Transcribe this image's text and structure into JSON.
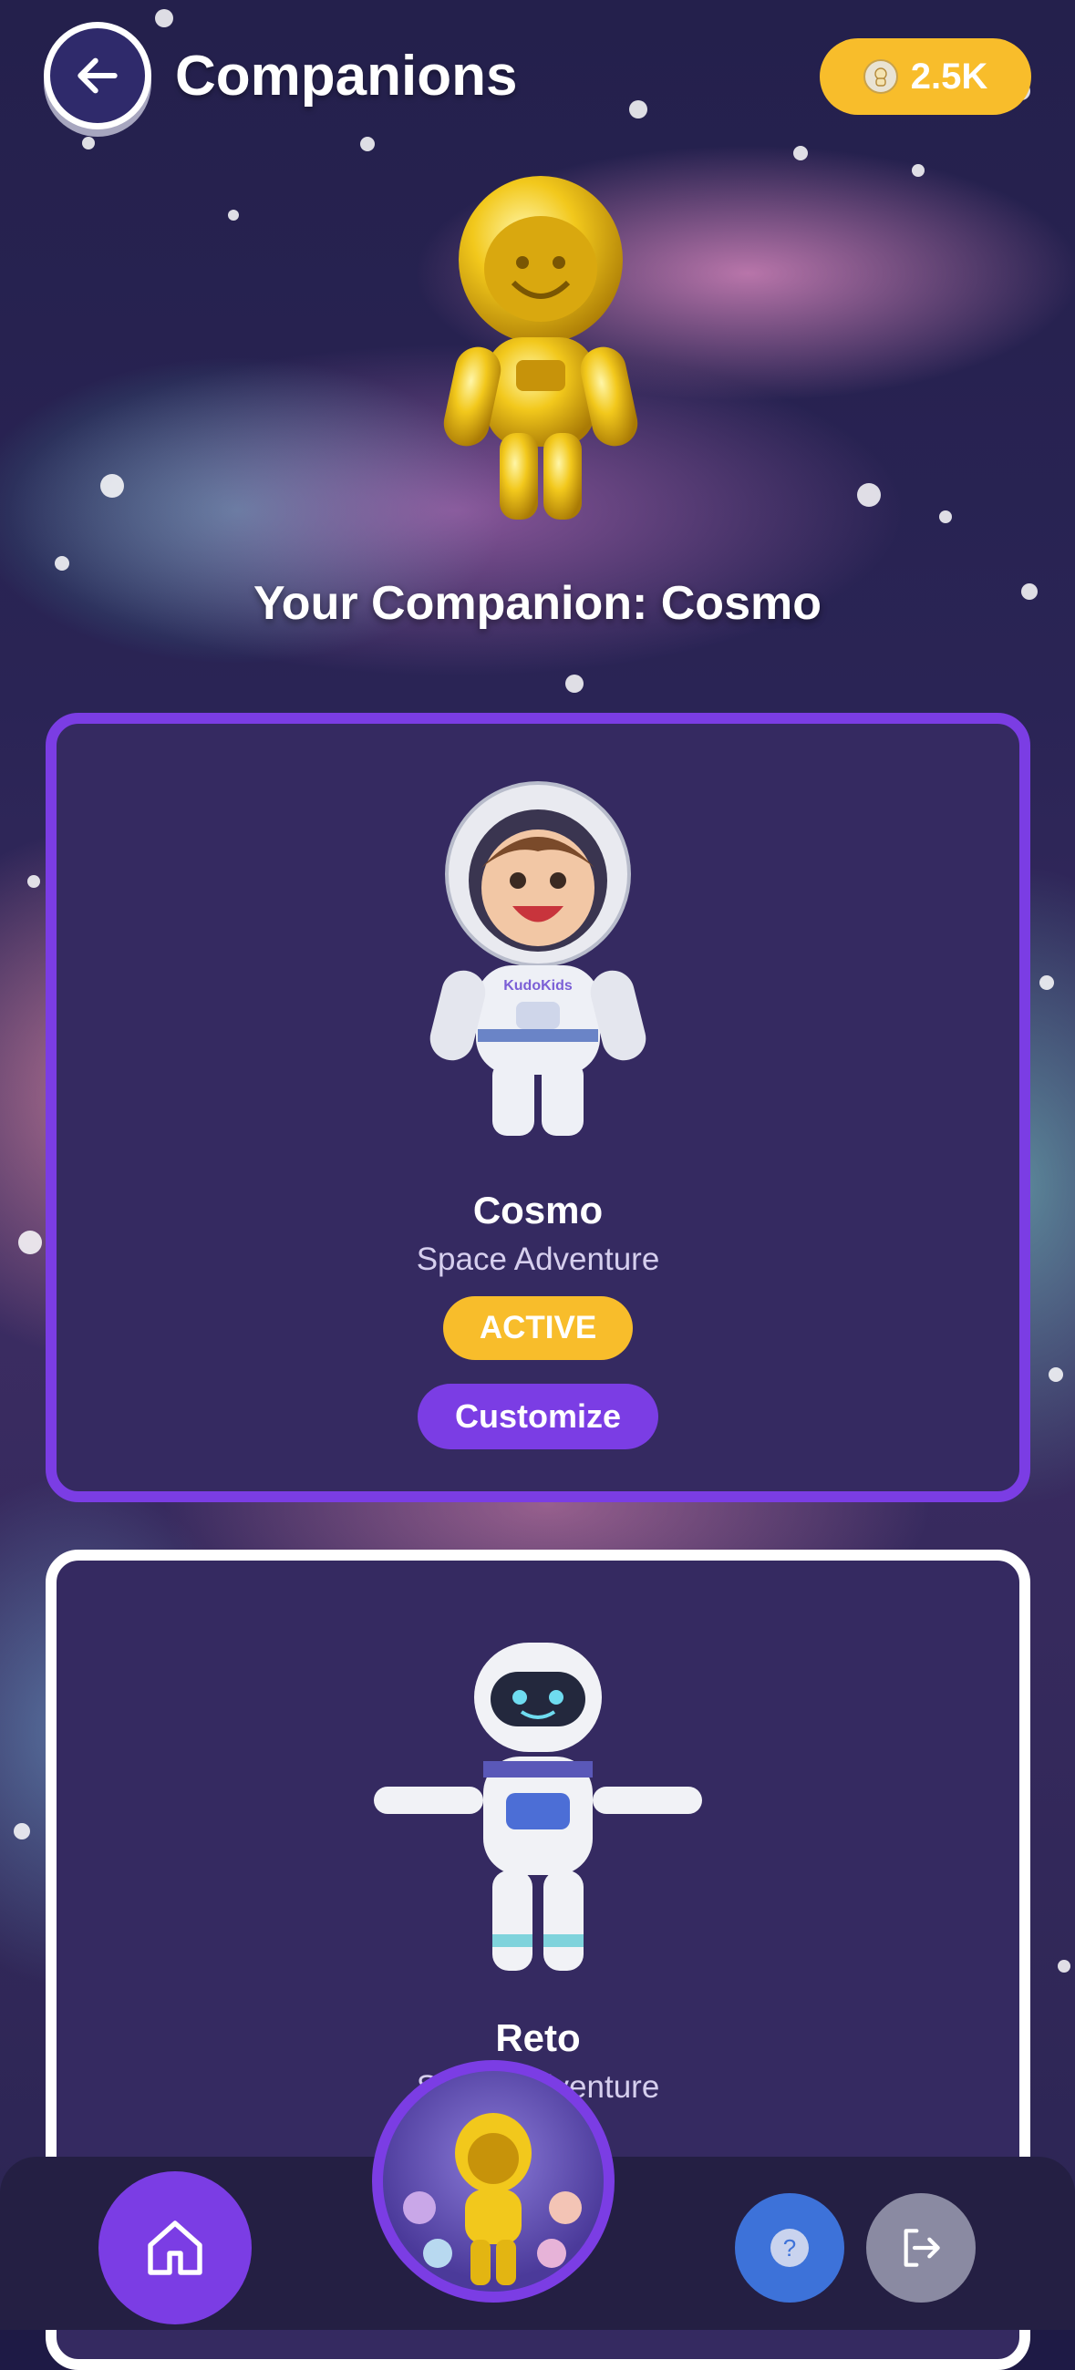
{
  "header": {
    "title": "Companions",
    "coins": "2.5K"
  },
  "hero": {
    "caption": "Your Companion: Cosmo"
  },
  "companions": [
    {
      "name": "Cosmo",
      "subtitle": "Space Adventure",
      "badge": "ACTIVE",
      "action": "Customize",
      "shirt_text": "KudoKids"
    },
    {
      "name": "Reto",
      "subtitle": "Space Adventure"
    }
  ],
  "bottom_nav": {
    "items": [
      "home-icon",
      "companion-avatar",
      "help-icon",
      "exit-icon"
    ],
    "help_glyph": "?"
  },
  "colors": {
    "accent_purple": "#7b3de4",
    "gold": "#f8bd2b",
    "card_bg": "#352a61",
    "help_blue": "#3d72d9",
    "exit_gray": "#8a8aa2"
  }
}
